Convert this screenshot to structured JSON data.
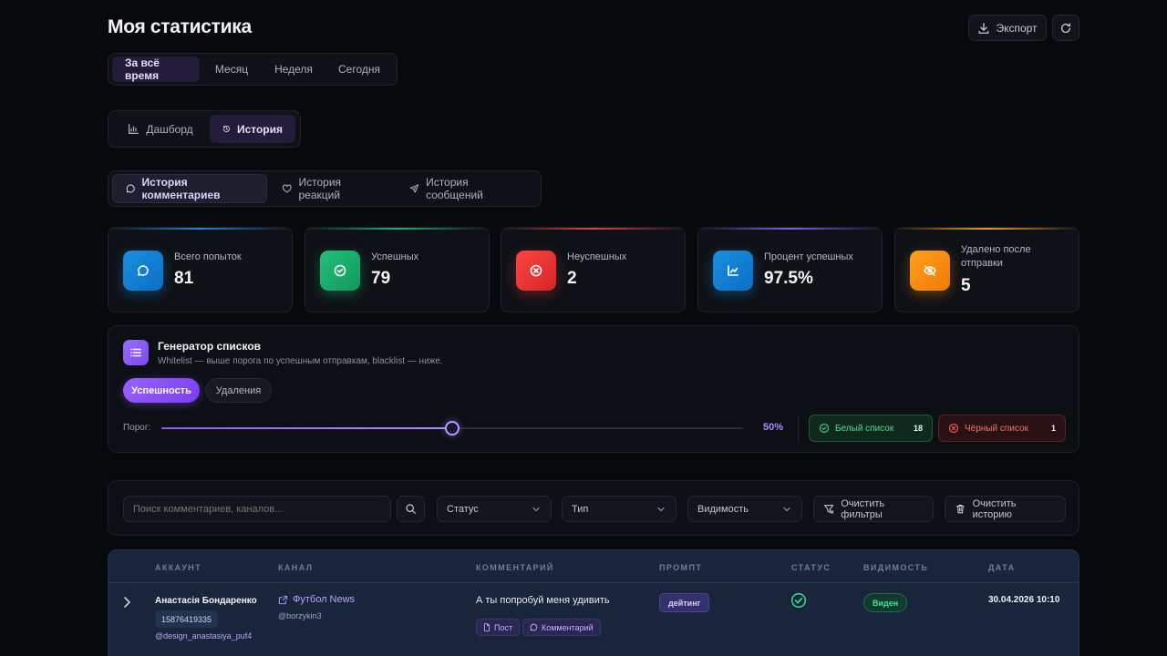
{
  "header": {
    "title": "Моя статистика",
    "export_label": "Экспорт"
  },
  "period_tabs": [
    "За всё время",
    "Месяц",
    "Неделя",
    "Сегодня"
  ],
  "view_tabs": [
    "Дашборд",
    "История"
  ],
  "history_tabs": [
    "История комментариев",
    "История реакций",
    "История сообщений"
  ],
  "stats": [
    {
      "label": "Всего попыток",
      "value": "81",
      "color": "#2a9fe0"
    },
    {
      "label": "Успешных",
      "value": "79",
      "color": "#22c07a"
    },
    {
      "label": "Неуспешных",
      "value": "2",
      "color": "#ef3b3b"
    },
    {
      "label": "Процент успешных",
      "value": "97.5%",
      "color": "#2a9fe0"
    },
    {
      "label": "Удалено после отправки",
      "value": "5",
      "color": "#ff9512"
    }
  ],
  "generator": {
    "title": "Генератор списков",
    "subtitle": "Whitelist — выше порога по успешным отправкам, blacklist — ниже.",
    "mode_success": "Успешность",
    "mode_deletions": "Удаления",
    "threshold_label": "Порог:",
    "threshold_value": 0.5,
    "threshold_text": "50%",
    "whitelist_label": "Белый список",
    "whitelist_count": "18",
    "blacklist_label": "Чёрный список",
    "blacklist_count": "1"
  },
  "filters": {
    "search_placeholder": "Поиск комментариев, каналов...",
    "status": "Статус",
    "type": "Тип",
    "visibility": "Видимость",
    "clear_filters": "Очистить фильтры",
    "clear_history": "Очистить историю"
  },
  "table": {
    "columns": [
      "АККАУНТ",
      "КАНАЛ",
      "КОММЕНТАРИЙ",
      "ПРОМПТ",
      "СТАТУС",
      "ВИДИМОСТЬ",
      "ДАТА"
    ],
    "rows": [
      {
        "account_name": "Анастасія Бондаренко",
        "account_id": "15876419335",
        "account_handle": "@design_anastasiya_puf4",
        "channel_name": "Футбол News",
        "channel_handle": "@borzykin3",
        "comment": "А ты попробуй меня удивить",
        "tag_post": "Пост",
        "tag_comment": "Комментарий",
        "prompt": "дейтинг",
        "visibility": "Виден",
        "date": "30.04.2026 10:10"
      }
    ]
  }
}
